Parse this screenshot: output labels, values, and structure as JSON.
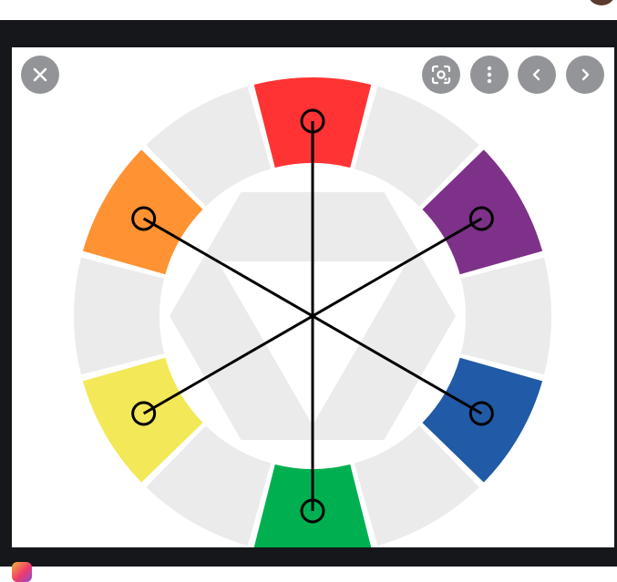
{
  "viewer": {
    "close_icon": "close-icon",
    "lens_icon": "google-lens-icon",
    "more_icon": "more-vertical-icon",
    "prev_icon": "chevron-left-icon",
    "next_icon": "chevron-right-icon",
    "source_icon": "source-site-icon"
  },
  "image": {
    "segment_colors": [
      "#ff3333",
      "#7d3189",
      "#215aa6",
      "#00b050",
      "#f3e858",
      "#ff9233"
    ],
    "neutral_color": "#ebebeb",
    "line_color": "#000000"
  }
}
